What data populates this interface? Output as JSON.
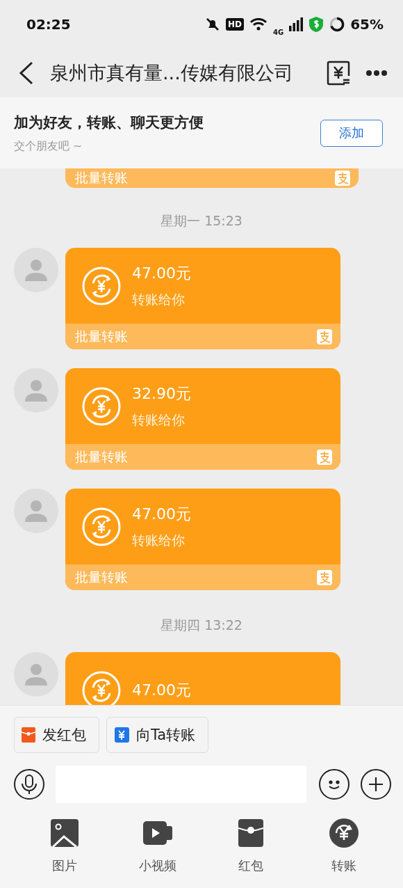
{
  "status_bar": {
    "time": "02:25",
    "hd": "HD",
    "network": "4G",
    "battery": "65%"
  },
  "header": {
    "title": "泉州市真有量...传媒有限公司"
  },
  "banner": {
    "title": "加为好友，转账、聊天更方便",
    "subtitle": "交个朋友吧 ~",
    "button": "添加"
  },
  "messages": [
    {
      "kind": "transfer_footer",
      "footer": "批量转账"
    },
    {
      "kind": "time",
      "text": "星期一 15:23"
    },
    {
      "kind": "transfer",
      "amount": "47.00元",
      "note": "转账给你",
      "footer": "批量转账"
    },
    {
      "kind": "transfer",
      "amount": "32.90元",
      "note": "转账给你",
      "footer": "批量转账"
    },
    {
      "kind": "transfer",
      "amount": "47.00元",
      "note": "转账给你",
      "footer": "批量转账"
    },
    {
      "kind": "time",
      "text": "星期四 13:22"
    },
    {
      "kind": "transfer",
      "amount": "47.00元"
    }
  ],
  "quick_actions": [
    {
      "kind": "red_packet",
      "label": "发红包"
    },
    {
      "kind": "transfer",
      "label": "向Ta转账"
    }
  ],
  "tools": [
    {
      "kind": "image",
      "label": "图片"
    },
    {
      "kind": "video",
      "label": "小视频"
    },
    {
      "kind": "red_packet",
      "label": "红包"
    },
    {
      "kind": "transfer",
      "label": "转账"
    }
  ]
}
